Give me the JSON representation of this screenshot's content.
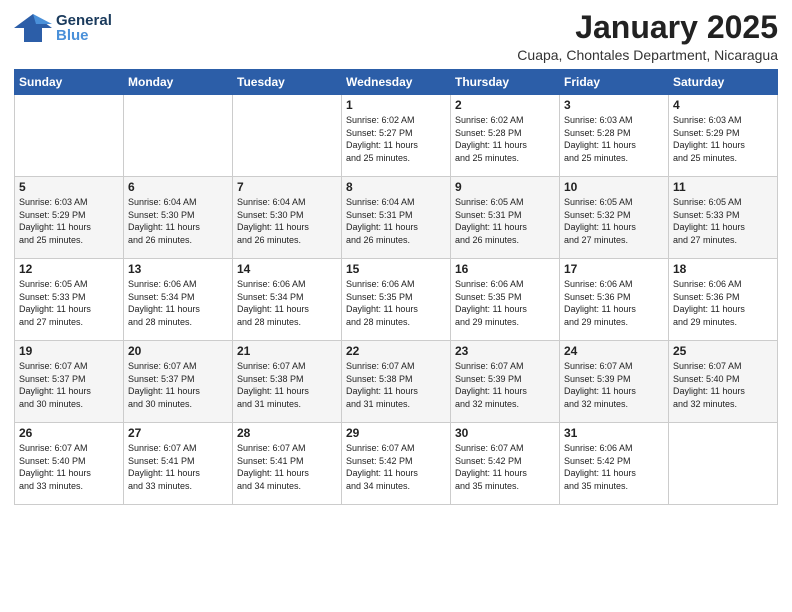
{
  "logo": {
    "line1": "General",
    "line2": "Blue"
  },
  "title": "January 2025",
  "subtitle": "Cuapa, Chontales Department, Nicaragua",
  "days_header": [
    "Sunday",
    "Monday",
    "Tuesday",
    "Wednesday",
    "Thursday",
    "Friday",
    "Saturday"
  ],
  "weeks": [
    [
      {
        "day": "",
        "info": ""
      },
      {
        "day": "",
        "info": ""
      },
      {
        "day": "",
        "info": ""
      },
      {
        "day": "1",
        "info": "Sunrise: 6:02 AM\nSunset: 5:27 PM\nDaylight: 11 hours\nand 25 minutes."
      },
      {
        "day": "2",
        "info": "Sunrise: 6:02 AM\nSunset: 5:28 PM\nDaylight: 11 hours\nand 25 minutes."
      },
      {
        "day": "3",
        "info": "Sunrise: 6:03 AM\nSunset: 5:28 PM\nDaylight: 11 hours\nand 25 minutes."
      },
      {
        "day": "4",
        "info": "Sunrise: 6:03 AM\nSunset: 5:29 PM\nDaylight: 11 hours\nand 25 minutes."
      }
    ],
    [
      {
        "day": "5",
        "info": "Sunrise: 6:03 AM\nSunset: 5:29 PM\nDaylight: 11 hours\nand 25 minutes."
      },
      {
        "day": "6",
        "info": "Sunrise: 6:04 AM\nSunset: 5:30 PM\nDaylight: 11 hours\nand 26 minutes."
      },
      {
        "day": "7",
        "info": "Sunrise: 6:04 AM\nSunset: 5:30 PM\nDaylight: 11 hours\nand 26 minutes."
      },
      {
        "day": "8",
        "info": "Sunrise: 6:04 AM\nSunset: 5:31 PM\nDaylight: 11 hours\nand 26 minutes."
      },
      {
        "day": "9",
        "info": "Sunrise: 6:05 AM\nSunset: 5:31 PM\nDaylight: 11 hours\nand 26 minutes."
      },
      {
        "day": "10",
        "info": "Sunrise: 6:05 AM\nSunset: 5:32 PM\nDaylight: 11 hours\nand 27 minutes."
      },
      {
        "day": "11",
        "info": "Sunrise: 6:05 AM\nSunset: 5:33 PM\nDaylight: 11 hours\nand 27 minutes."
      }
    ],
    [
      {
        "day": "12",
        "info": "Sunrise: 6:05 AM\nSunset: 5:33 PM\nDaylight: 11 hours\nand 27 minutes."
      },
      {
        "day": "13",
        "info": "Sunrise: 6:06 AM\nSunset: 5:34 PM\nDaylight: 11 hours\nand 28 minutes."
      },
      {
        "day": "14",
        "info": "Sunrise: 6:06 AM\nSunset: 5:34 PM\nDaylight: 11 hours\nand 28 minutes."
      },
      {
        "day": "15",
        "info": "Sunrise: 6:06 AM\nSunset: 5:35 PM\nDaylight: 11 hours\nand 28 minutes."
      },
      {
        "day": "16",
        "info": "Sunrise: 6:06 AM\nSunset: 5:35 PM\nDaylight: 11 hours\nand 29 minutes."
      },
      {
        "day": "17",
        "info": "Sunrise: 6:06 AM\nSunset: 5:36 PM\nDaylight: 11 hours\nand 29 minutes."
      },
      {
        "day": "18",
        "info": "Sunrise: 6:06 AM\nSunset: 5:36 PM\nDaylight: 11 hours\nand 29 minutes."
      }
    ],
    [
      {
        "day": "19",
        "info": "Sunrise: 6:07 AM\nSunset: 5:37 PM\nDaylight: 11 hours\nand 30 minutes."
      },
      {
        "day": "20",
        "info": "Sunrise: 6:07 AM\nSunset: 5:37 PM\nDaylight: 11 hours\nand 30 minutes."
      },
      {
        "day": "21",
        "info": "Sunrise: 6:07 AM\nSunset: 5:38 PM\nDaylight: 11 hours\nand 31 minutes."
      },
      {
        "day": "22",
        "info": "Sunrise: 6:07 AM\nSunset: 5:38 PM\nDaylight: 11 hours\nand 31 minutes."
      },
      {
        "day": "23",
        "info": "Sunrise: 6:07 AM\nSunset: 5:39 PM\nDaylight: 11 hours\nand 32 minutes."
      },
      {
        "day": "24",
        "info": "Sunrise: 6:07 AM\nSunset: 5:39 PM\nDaylight: 11 hours\nand 32 minutes."
      },
      {
        "day": "25",
        "info": "Sunrise: 6:07 AM\nSunset: 5:40 PM\nDaylight: 11 hours\nand 32 minutes."
      }
    ],
    [
      {
        "day": "26",
        "info": "Sunrise: 6:07 AM\nSunset: 5:40 PM\nDaylight: 11 hours\nand 33 minutes."
      },
      {
        "day": "27",
        "info": "Sunrise: 6:07 AM\nSunset: 5:41 PM\nDaylight: 11 hours\nand 33 minutes."
      },
      {
        "day": "28",
        "info": "Sunrise: 6:07 AM\nSunset: 5:41 PM\nDaylight: 11 hours\nand 34 minutes."
      },
      {
        "day": "29",
        "info": "Sunrise: 6:07 AM\nSunset: 5:42 PM\nDaylight: 11 hours\nand 34 minutes."
      },
      {
        "day": "30",
        "info": "Sunrise: 6:07 AM\nSunset: 5:42 PM\nDaylight: 11 hours\nand 35 minutes."
      },
      {
        "day": "31",
        "info": "Sunrise: 6:06 AM\nSunset: 5:42 PM\nDaylight: 11 hours\nand 35 minutes."
      },
      {
        "day": "",
        "info": ""
      }
    ]
  ]
}
